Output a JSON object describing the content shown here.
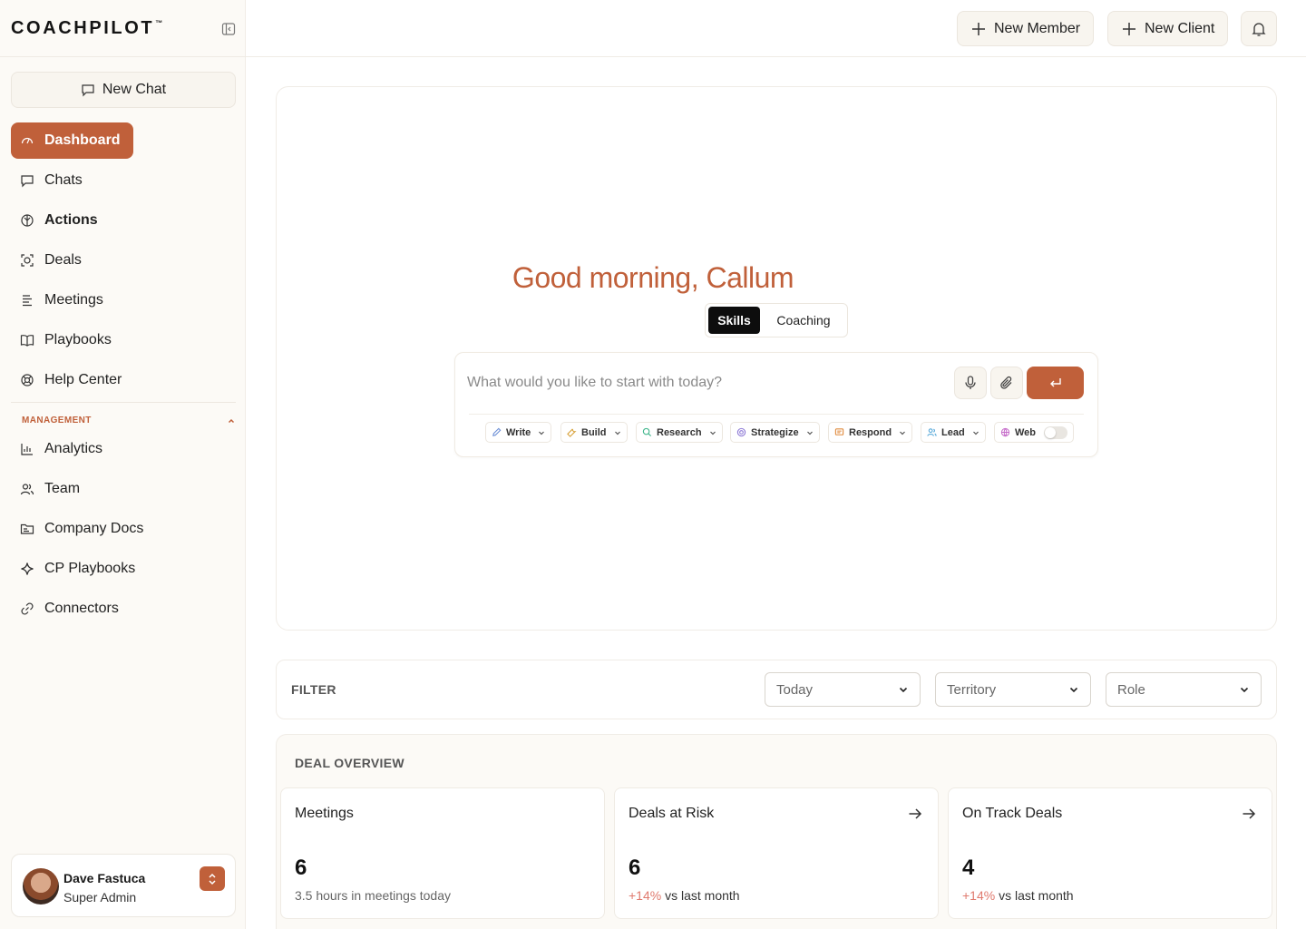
{
  "brand": {
    "name": "COACHPILOT",
    "trademark": "™"
  },
  "sidebar": {
    "new_chat_label": "New Chat",
    "items": [
      {
        "label": "Dashboard",
        "icon": "gauge-icon"
      },
      {
        "label": "Chats",
        "icon": "chat-icon"
      },
      {
        "label": "Actions",
        "icon": "actions-icon"
      },
      {
        "label": "Deals",
        "icon": "target-icon"
      },
      {
        "label": "Meetings",
        "icon": "list-icon"
      },
      {
        "label": "Playbooks",
        "icon": "book-icon"
      },
      {
        "label": "Help Center",
        "icon": "lifebuoy-icon"
      }
    ],
    "management": {
      "header": "MANAGEMENT",
      "items": [
        {
          "label": "Analytics",
          "icon": "bar-chart-icon"
        },
        {
          "label": "Team",
          "icon": "users-icon"
        },
        {
          "label": "Company Docs",
          "icon": "folder-icon"
        },
        {
          "label": "CP Playbooks",
          "icon": "sparkle-icon"
        },
        {
          "label": "Connectors",
          "icon": "link-icon"
        }
      ]
    },
    "user": {
      "name": "Dave Fastuca",
      "role": "Super Admin"
    }
  },
  "topbar": {
    "new_member_label": "New Member",
    "new_client_label": "New Client"
  },
  "hero": {
    "greeting": "Good morning, Callum",
    "tabs": [
      {
        "label": "Skills",
        "active": true
      },
      {
        "label": "Coaching",
        "active": false
      }
    ],
    "input_placeholder": "What would you like to start with today?",
    "chips": [
      {
        "label": "Write",
        "icon": "pen-icon",
        "color": "#6c8fd6"
      },
      {
        "label": "Build",
        "icon": "wrench-icon",
        "color": "#d8a23a"
      },
      {
        "label": "Research",
        "icon": "search-icon",
        "color": "#3db58a"
      },
      {
        "label": "Strategize",
        "icon": "target-icon",
        "color": "#8f7bd6"
      },
      {
        "label": "Respond",
        "icon": "message-icon",
        "color": "#e08a3c"
      },
      {
        "label": "Lead",
        "icon": "users-icon",
        "color": "#58a9d9"
      },
      {
        "label": "Web",
        "icon": "globe-icon",
        "color": "#c56bc9"
      }
    ]
  },
  "filter": {
    "label": "FILTER",
    "selects": [
      "Today",
      "Territory",
      "Role"
    ]
  },
  "deal_overview": {
    "title": "DEAL OVERVIEW",
    "cards": [
      {
        "title": "Meetings",
        "value": "6",
        "sub": "3.5 hours in meetings today",
        "delta": "",
        "has_arrow": false
      },
      {
        "title": "Deals at Risk",
        "value": "6",
        "sub": " vs last month",
        "delta": "+14%",
        "has_arrow": true
      },
      {
        "title": "On Track Deals",
        "value": "4",
        "sub": " vs last month",
        "delta": "+14%",
        "has_arrow": true
      }
    ]
  },
  "colors": {
    "accent": "#c0603a",
    "sidebar_bg": "#fcfaf6",
    "delta_positive": "#e07a6e"
  }
}
